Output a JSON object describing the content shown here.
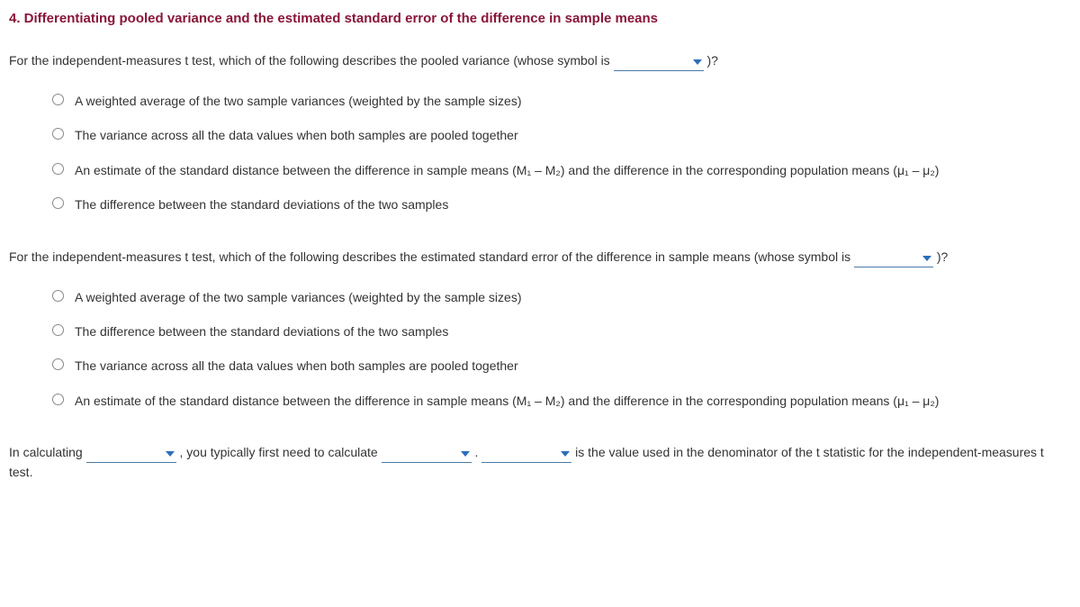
{
  "heading": "4. Differentiating pooled variance and the estimated standard error of the difference in sample means",
  "q1": {
    "prefix": "For the independent-measures t test, which of the following describes the pooled variance (whose symbol is ",
    "suffix": " )?",
    "options": [
      "A weighted average of the two sample variances (weighted by the sample sizes)",
      "The variance across all the data values when both samples are pooled together",
      "An estimate of the standard distance between the difference in sample means (M₁ – M₂) and the difference in the corresponding population means (μ₁ – μ₂)",
      "The difference between the standard deviations of the two samples"
    ]
  },
  "q2": {
    "prefix": "For the independent-measures t test, which of the following describes the estimated standard error of the difference in sample means (whose symbol is ",
    "suffix": " )?",
    "options": [
      "A weighted average of the two sample variances (weighted by the sample sizes)",
      "The difference between the standard deviations of the two samples",
      "The variance across all the data values when both samples are pooled together",
      "An estimate of the standard distance between the difference in sample means (M₁ – M₂) and the difference in the corresponding population means (μ₁ – μ₂)"
    ]
  },
  "q3": {
    "p1": "In calculating ",
    "p2": " , you typically first need to calculate ",
    "p3": " . ",
    "p4": " is the value used in the denominator of the t statistic for the independent-measures t test."
  }
}
